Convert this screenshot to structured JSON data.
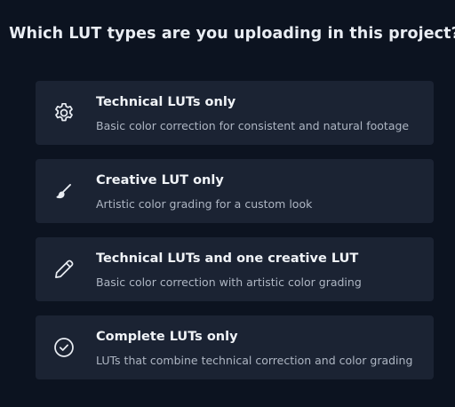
{
  "question": "Which LUT types are you uploading in this project?",
  "options": [
    {
      "icon": "gear-icon",
      "title": "Technical LUTs only",
      "description": "Basic color correction for consistent and natural footage"
    },
    {
      "icon": "paintbrush-icon",
      "title": "Creative LUT only",
      "description": "Artistic color grading for a custom look"
    },
    {
      "icon": "pencil-icon",
      "title": "Technical LUTs and one creative LUT",
      "description": "Basic color correction with artistic color grading"
    },
    {
      "icon": "check-circle-icon",
      "title": "Complete LUTs only",
      "description": "LUTs that combine technical correction and color grading"
    }
  ]
}
